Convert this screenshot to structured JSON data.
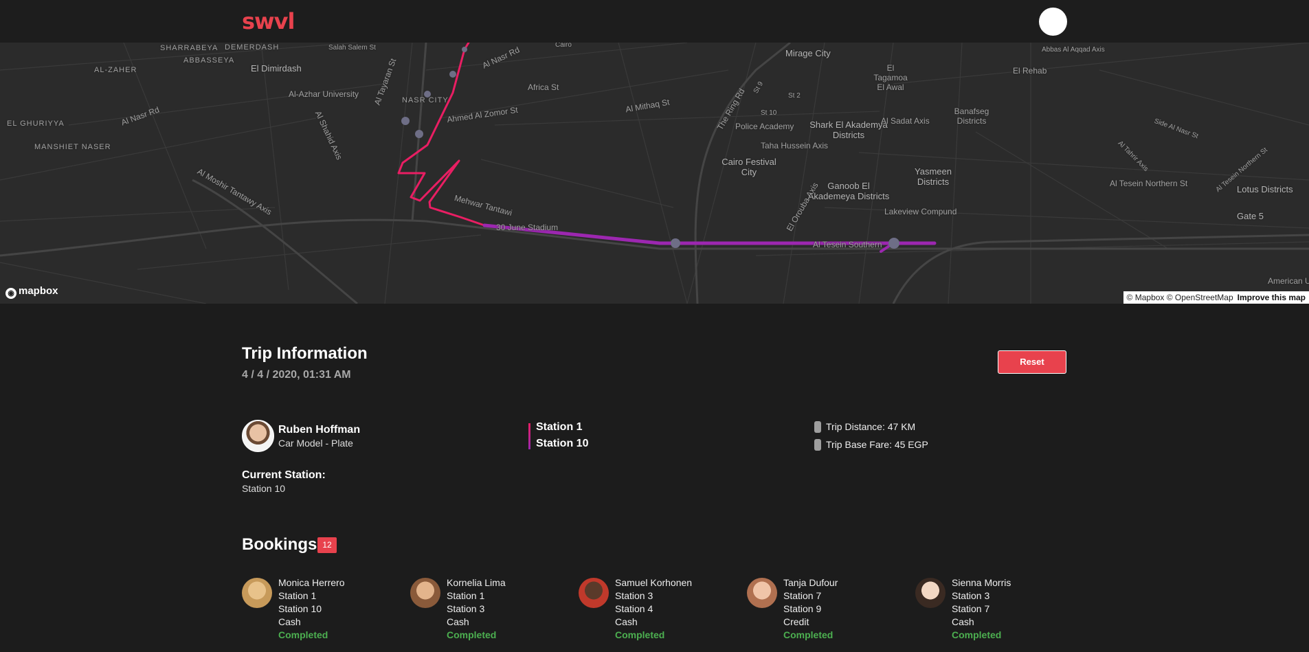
{
  "header": {
    "logo_text": "swvl"
  },
  "map": {
    "labels": [
      "SHARRABEYA",
      "DEMERDASH",
      "ABBASSEYA",
      "El Dimirdash",
      "AL-ZAHER",
      "Al-Azhar University",
      "NASR CITY",
      "EL GHURIYYA",
      "Al Nasr Rd",
      "Ahmed Al Zomor St",
      "Africa St",
      "Al Nasr Rd",
      "Al Tayaran St",
      "MANSHIET NASER",
      "Al Shahid Axis",
      "Al Moshir Tantawy Axis",
      "Mehwar Tantawi",
      "30 June Stadium",
      "Al Mithaq St",
      "The Ring Rd",
      "Police Academy",
      "Cairo Festival City",
      "Taha Hussein Axis",
      "Shark El Akademya Districts",
      "Ganoob El Akademeya Districts",
      "Mirage City",
      "El Tagamoa El Awal",
      "El Rehab",
      "Banafseg Districts",
      "Al Sadat Axis",
      "Yasmeen Districts",
      "Lakeview Compund",
      "Al Tesein Northern St",
      "Lotus Districts",
      "Gate 5",
      "Al Tesein Southern",
      "Abbas Al Aqqad Axis",
      "Side Al Nasr St",
      "Al Tahrir Axis",
      "Al Tesein Northern St",
      "St 9",
      "St 2",
      "St 10",
      "El Orouba Axis",
      "Salah Salem St",
      "Cairo",
      "American U",
      "The Ring Rd"
    ],
    "brand": "mapbox",
    "attribution": "© Mapbox © OpenStreetMap",
    "improve_link": "Improve this map",
    "route_colors": {
      "start": "#e91e63",
      "end": "#9c27b0"
    },
    "stop_color": "#6e6e86"
  },
  "trip": {
    "title": "Trip Information",
    "date": "4 / 4 / 2020, 01:31 AM",
    "reset_label": "Reset",
    "driver": {
      "name": "Ruben Hoffman",
      "car": "Car Model - Plate"
    },
    "current_station_label": "Current Station:",
    "current_station": "Station 10",
    "route_from": "Station 1",
    "route_to": "Station 10",
    "distance": "Trip Distance: 47 KM",
    "base_fare": "Trip Base Fare: 45 EGP"
  },
  "bookings": {
    "title": "Bookings",
    "count": "12",
    "items": [
      {
        "name": "Monica Herrero",
        "pickup": "Station 1",
        "dropoff": "Station 10",
        "payment": "Cash",
        "status": "Completed",
        "avatar_colors": [
          "#e8c28a",
          "#c79a5a"
        ]
      },
      {
        "name": "Kornelia Lima",
        "pickup": "Station 1",
        "dropoff": "Station 3",
        "payment": "Cash",
        "status": "Completed",
        "avatar_colors": [
          "#e3b48c",
          "#8a5a3a"
        ]
      },
      {
        "name": "Samuel Korhonen",
        "pickup": "Station 3",
        "dropoff": "Station 4",
        "payment": "Cash",
        "status": "Completed",
        "avatar_colors": [
          "#5a3a2a",
          "#c0392b"
        ]
      },
      {
        "name": "Tanja Dufour",
        "pickup": "Station 7",
        "dropoff": "Station 9",
        "payment": "Credit",
        "status": "Completed",
        "avatar_colors": [
          "#f0c4a8",
          "#b07050"
        ]
      },
      {
        "name": "Sienna Morris",
        "pickup": "Station 3",
        "dropoff": "Station 7",
        "payment": "Cash",
        "status": "Completed",
        "avatar_colors": [
          "#f3d8c4",
          "#3a2a22"
        ]
      }
    ]
  }
}
